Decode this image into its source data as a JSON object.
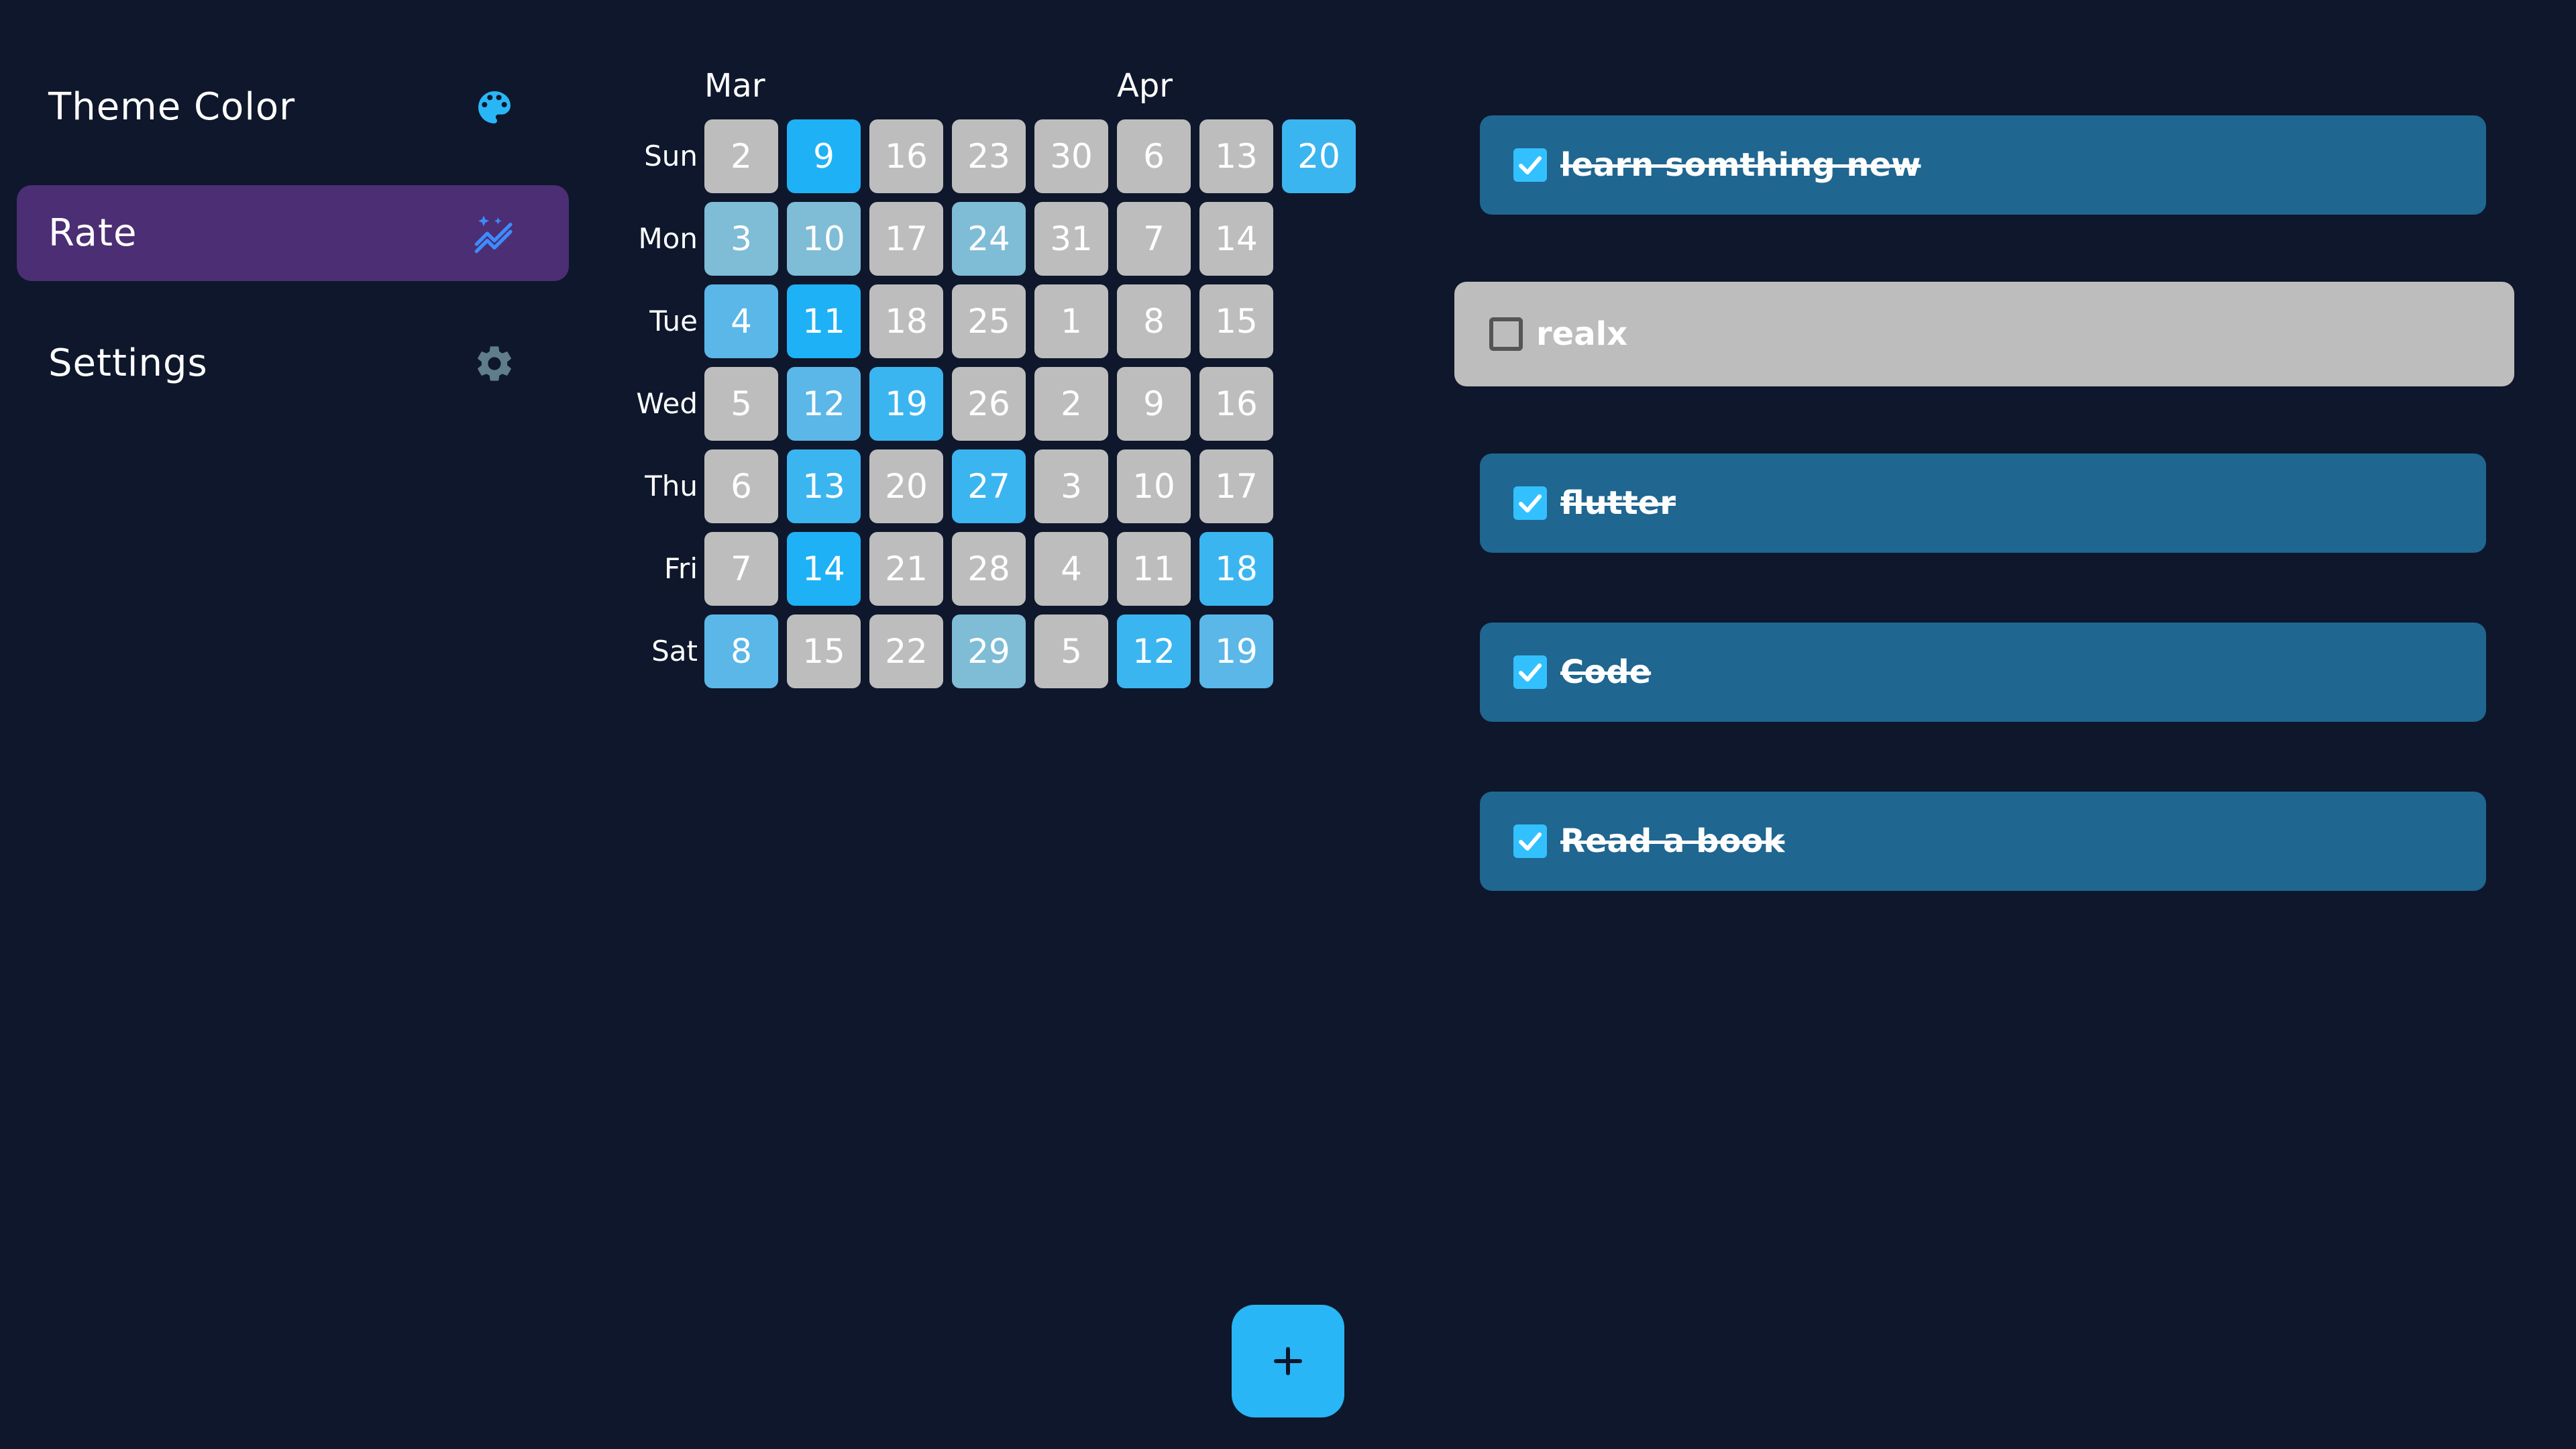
{
  "sidebar": {
    "items": [
      {
        "label": "Theme Color",
        "icon": "palette-icon",
        "active": false
      },
      {
        "label": "Rate",
        "icon": "auto-graph-icon",
        "active": true
      },
      {
        "label": "Settings",
        "icon": "gear-icon",
        "active": false
      }
    ]
  },
  "heatmap": {
    "months": [
      "Mar",
      "Apr"
    ],
    "weekdays": [
      "Sun",
      "Mon",
      "Tue",
      "Wed",
      "Thu",
      "Fri",
      "Sat"
    ],
    "weeks": [
      [
        2,
        3,
        4,
        5,
        6,
        7,
        8
      ],
      [
        9,
        10,
        11,
        12,
        13,
        14,
        15
      ],
      [
        16,
        17,
        18,
        19,
        20,
        21,
        22
      ],
      [
        23,
        24,
        25,
        26,
        27,
        28,
        29
      ],
      [
        30,
        31,
        1,
        2,
        3,
        4,
        5
      ],
      [
        6,
        7,
        8,
        9,
        10,
        11,
        12
      ],
      [
        13,
        14,
        15,
        16,
        17,
        18,
        19
      ],
      [
        20
      ]
    ],
    "intensity": [
      [
        0,
        1,
        2,
        0,
        0,
        0,
        2
      ],
      [
        4,
        1,
        4,
        2,
        3,
        4,
        0
      ],
      [
        0,
        0,
        0,
        3,
        0,
        0,
        0
      ],
      [
        0,
        1,
        0,
        0,
        3,
        0,
        1
      ],
      [
        0,
        0,
        0,
        0,
        0,
        0,
        0
      ],
      [
        0,
        0,
        0,
        0,
        0,
        0,
        3
      ],
      [
        0,
        0,
        0,
        0,
        0,
        3,
        2
      ],
      [
        3
      ]
    ],
    "colors": [
      "#bdbdbd",
      "#7fbcd6",
      "#5ab7e8",
      "#3bb5f0",
      "#1eb1f5"
    ]
  },
  "tasks": [
    {
      "label": "learn somthing new",
      "done": true
    },
    {
      "label": "realx",
      "done": false
    },
    {
      "label": "flutter",
      "done": true
    },
    {
      "label": "Code",
      "done": true
    },
    {
      "label": "Read a book",
      "done": true
    }
  ],
  "fab": {
    "icon": "plus-icon"
  }
}
